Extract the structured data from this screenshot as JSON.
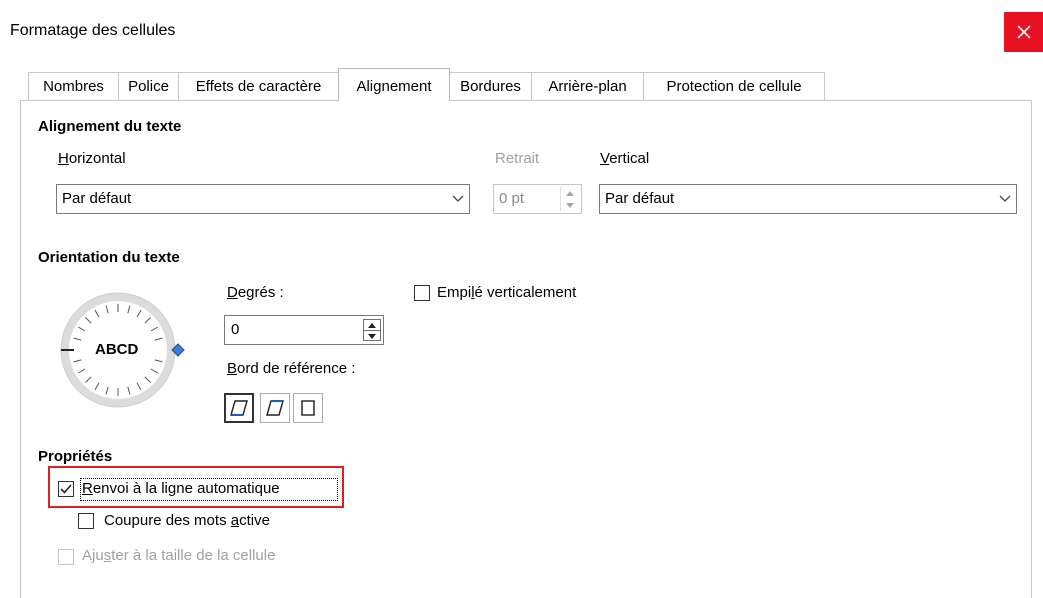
{
  "window": {
    "title": "Formatage des cellules"
  },
  "tabs": [
    {
      "label": "Nombres",
      "active": false
    },
    {
      "label": "Police",
      "active": false
    },
    {
      "label": "Effets de caractère",
      "active": false
    },
    {
      "label": "Alignement",
      "active": true
    },
    {
      "label": "Bordures",
      "active": false
    },
    {
      "label": "Arrière-plan",
      "active": false
    },
    {
      "label": "Protection de cellule",
      "active": false
    }
  ],
  "text_alignment": {
    "title": "Alignement du texte",
    "horizontal": {
      "label_mnemonic": "H",
      "label_rest": "orizontal",
      "value": "Par défaut"
    },
    "indent": {
      "label": "Retrait",
      "value": "0 pt"
    },
    "vertical": {
      "label_mnemonic": "V",
      "label_rest": "ertical",
      "value": "Par défaut"
    }
  },
  "text_orientation": {
    "title": "Orientation du texte",
    "dial_text": "ABCD",
    "degrees": {
      "label_mnemonic": "D",
      "label_rest": "egrés :",
      "value": "0"
    },
    "stacked": {
      "label_pre": "Empi",
      "label_mnemonic": "l",
      "label_post": "é verticalement",
      "checked": false
    },
    "reference_edge": {
      "label_mnemonic": "B",
      "label_rest": "ord de référence :",
      "selected_index": 0
    }
  },
  "properties": {
    "title": "Propriétés",
    "wrap": {
      "label_mnemonic": "R",
      "label_rest": "envoi à la ligne automatique",
      "checked": true
    },
    "hyphenation": {
      "label_pre": "Coupure des mots ",
      "label_mnemonic": "a",
      "label_post": "ctive",
      "checked": false
    },
    "shrink": {
      "label_pre": "Aju",
      "label_mnemonic": "s",
      "label_post": "ter à la taille de la cellule",
      "checked": false,
      "disabled": true
    }
  },
  "colors": {
    "close_button": "#e81123",
    "highlight": "#e02020"
  },
  "icons": {
    "close": "close-icon",
    "dropdown": "chevron-down-icon",
    "spin": "spin-arrows-icon",
    "check": "checkmark-icon"
  }
}
